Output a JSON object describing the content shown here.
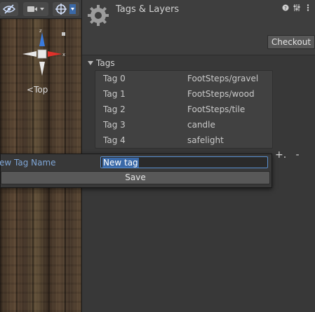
{
  "scene": {
    "view_label": "Top",
    "gizmo_axes": {
      "x": "x",
      "y": "y",
      "z": "z"
    },
    "icons": [
      "visibility-toggle-icon",
      "camera-icon",
      "gizmo-icon",
      "dropdown-arrow-icon"
    ]
  },
  "inspector": {
    "title": "Tags & Layers",
    "tool_icons": [
      "help-icon",
      "preset-icon",
      "more-options-icon"
    ],
    "checkout_label": "Checkout",
    "tags_section_label": "Tags",
    "tags": [
      {
        "name": "Tag 0",
        "value": "FootSteps/gravel"
      },
      {
        "name": "Tag 1",
        "value": "FootSteps/wood"
      },
      {
        "name": "Tag 2",
        "value": "FootSteps/tile"
      },
      {
        "name": "Tag 3",
        "value": "candle"
      },
      {
        "name": "Tag 4",
        "value": "safelight"
      }
    ],
    "add_label": "+.",
    "remove_label": "-"
  },
  "popup": {
    "label": "ew Tag Name",
    "input_value": "New tag",
    "save_label": "Save"
  },
  "colors": {
    "accent": "#3a69a8",
    "gizmo_x": "#e0312a",
    "gizmo_y": "#9ad24a",
    "gizmo_z": "#3a7bde"
  }
}
